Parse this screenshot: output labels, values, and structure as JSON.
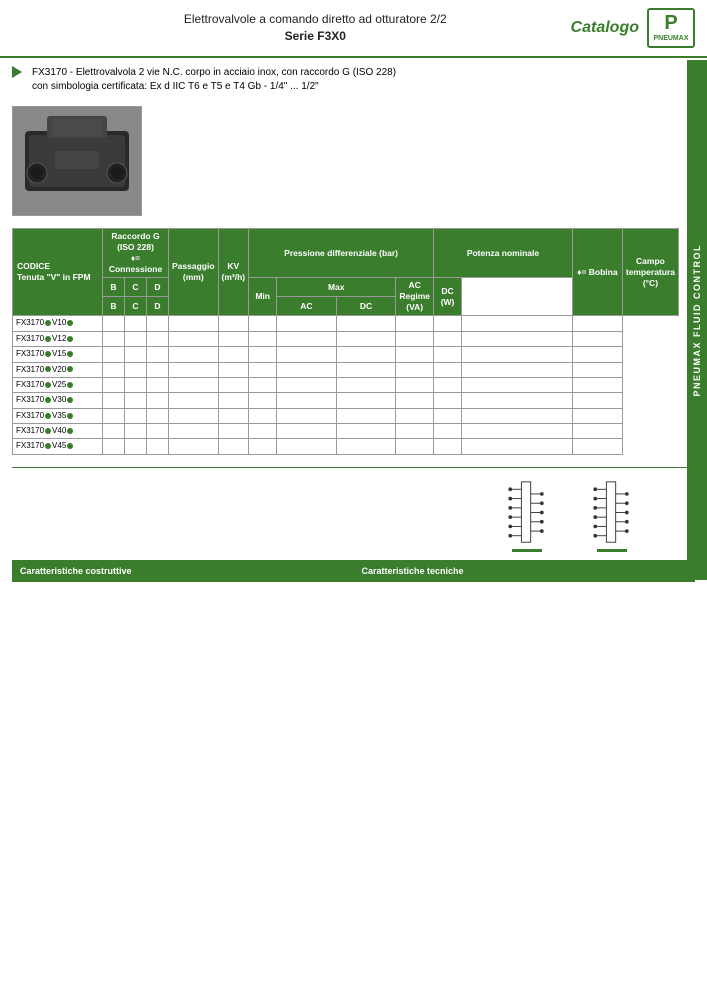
{
  "header": {
    "title_line1": "Elettrovalvole a comando diretto ad otturatore 2/2",
    "title_line2": "Serie F3X0",
    "catalog_label": "Catalogo",
    "logo_text": "PNEUMAX"
  },
  "product": {
    "code_prefix": "FX3170",
    "description_line1": "FX3170 - Elettrovalvola 2 vie N.C. corpo in acciaio inox, con raccordo G (ISO 228)",
    "description_line2": "con simbologia certificata: Ex d IIC T6 e T5 e T4 Gb - 1/4\" ... 1/2\""
  },
  "table": {
    "headers": {
      "code": "CODICE",
      "seal": "Tenuta \"V\" in FPM",
      "raccordo_g": "Raccordo G (ISO 228)",
      "connessione": "♦= Connessione",
      "col_b": "B",
      "col_c": "C",
      "col_d": "D",
      "passaggio": "Passaggio (mm)",
      "kv": "KV (m³/h)",
      "pressione": "Pressione differenziale (bar)",
      "press_min": "Min",
      "press_max": "Max",
      "press_ac": "AC",
      "press_dc": "DC",
      "potenza": "Potenza nominale",
      "ac_regime": "AC Regime (VA)",
      "dc_w": "DC (W)",
      "bobina": "♦= Bobina",
      "campo_temp": "Campo temperatura (°C)"
    },
    "rows": [
      {
        "code": "FX3170●V10●",
        "b": "",
        "c": "",
        "d": "",
        "pass": "",
        "kv": "",
        "min": "",
        "max_ac": "",
        "max_dc": "",
        "ac": "",
        "dc": "",
        "temp": ""
      },
      {
        "code": "FX3170●V12●",
        "b": "",
        "c": "",
        "d": "",
        "pass": "",
        "kv": "",
        "min": "",
        "max_ac": "",
        "max_dc": "",
        "ac": "",
        "dc": "",
        "temp": ""
      },
      {
        "code": "FX3170●V15●",
        "b": "",
        "c": "",
        "d": "",
        "pass": "",
        "kv": "",
        "min": "",
        "max_ac": "",
        "max_dc": "",
        "ac": "",
        "dc": "",
        "temp": ""
      },
      {
        "code": "FX3170●V20●",
        "b": "",
        "c": "",
        "d": "",
        "pass": "",
        "kv": "",
        "min": "",
        "max_ac": "",
        "max_dc": "",
        "ac": "",
        "dc": "",
        "temp": ""
      },
      {
        "code": "FX3170●V25●",
        "b": "",
        "c": "",
        "d": "",
        "pass": "",
        "kv": "",
        "min": "",
        "max_ac": "",
        "max_dc": "",
        "ac": "",
        "dc": "",
        "temp": ""
      },
      {
        "code": "FX3170●V30●",
        "b": "",
        "c": "",
        "d": "",
        "pass": "",
        "kv": "",
        "min": "",
        "max_ac": "",
        "max_dc": "",
        "ac": "",
        "dc": "",
        "temp": ""
      },
      {
        "code": "FX3170●V35●",
        "b": "",
        "c": "",
        "d": "",
        "pass": "",
        "kv": "",
        "min": "",
        "max_ac": "",
        "max_dc": "",
        "ac": "",
        "dc": "",
        "temp": ""
      },
      {
        "code": "FX3170●V40●",
        "b": "",
        "c": "",
        "d": "",
        "pass": "",
        "kv": "",
        "min": "",
        "max_ac": "",
        "max_dc": "",
        "ac": "",
        "dc": "",
        "temp": ""
      },
      {
        "code": "FX3170●V45●",
        "b": "",
        "c": "",
        "d": "",
        "pass": "",
        "kv": "",
        "min": "",
        "max_ac": "",
        "max_dc": "",
        "ac": "",
        "dc": "",
        "temp": ""
      }
    ]
  },
  "bottom_bar": {
    "left": "Caratteristiche costruttive",
    "right": "Caratteristiche tecniche"
  },
  "side_bar_text": "PNEUMAX FLUID CONTROL"
}
